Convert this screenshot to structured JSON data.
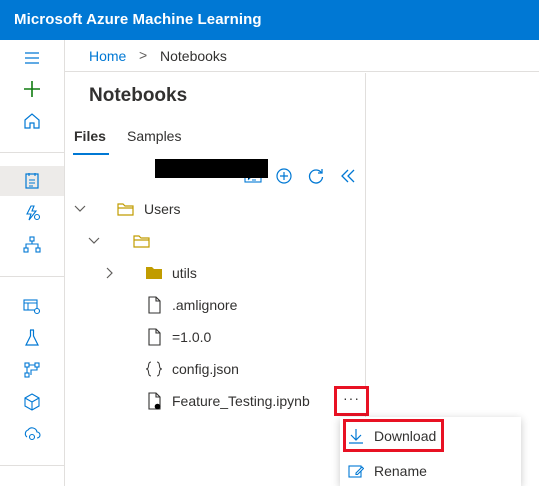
{
  "app": {
    "title": "Microsoft Azure Machine Learning"
  },
  "breadcrumb": {
    "home": "Home",
    "separator": ">",
    "current": "Notebooks"
  },
  "panel": {
    "title": "Notebooks",
    "tabs": [
      {
        "label": "Files"
      },
      {
        "label": "Samples"
      }
    ],
    "active_tab": "Files"
  },
  "tree": {
    "users": "Users",
    "redacted_folder": "",
    "utils": "utils",
    "amlignore": ".amlignore",
    "version_file": "=1.0.0",
    "config": "config.json",
    "notebook": "Feature_Testing.ipynb"
  },
  "more_button": {
    "glyph": "···"
  },
  "context_menu": {
    "download": "Download",
    "rename": "Rename"
  },
  "colors": {
    "brand": "#0078d4",
    "highlight": "#e81123",
    "folder": "#c19c00",
    "add_icon": "#107c10"
  }
}
